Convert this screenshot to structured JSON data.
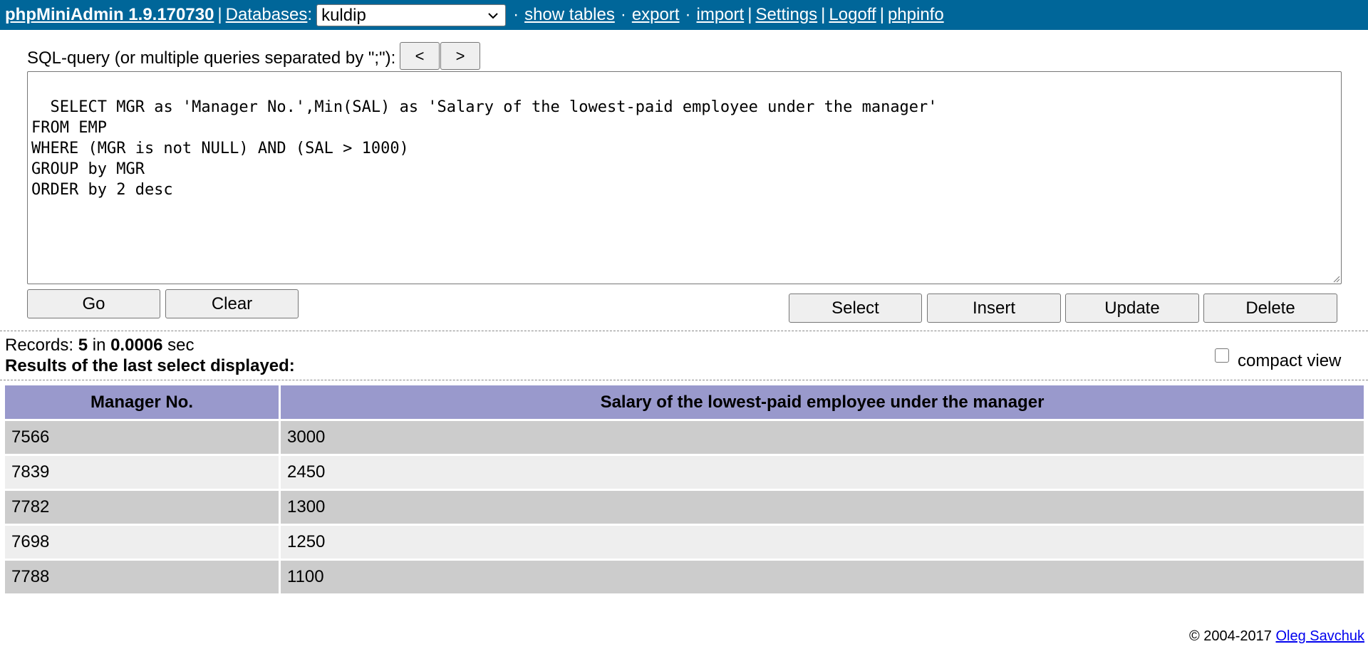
{
  "topbar": {
    "brand": "phpMiniAdmin 1.9.170730",
    "pipe": "|",
    "databases_label": "Databases",
    "colon": ":",
    "selected_db": "kuldip",
    "dot": "·",
    "show_tables": "show tables",
    "export": "export",
    "import": "import",
    "settings": "Settings",
    "logoff": "Logoff",
    "phpinfo": "phpinfo"
  },
  "sql": {
    "label": "SQL-query (or multiple queries separated by \";\"):",
    "prev": "<",
    "next": ">",
    "query": "SELECT MGR as 'Manager No.',Min(SAL) as 'Salary of the lowest-paid employee under the manager'\nFROM EMP\nWHERE (MGR is not NULL) AND (SAL > 1000)\nGROUP by MGR\nORDER by 2 desc",
    "go": "Go",
    "clear": "Clear",
    "select": "Select",
    "insert": "Insert",
    "update": "Update",
    "delete": "Delete"
  },
  "status": {
    "records_label": "Records: ",
    "records_count": "5",
    "in_label": " in ",
    "time": "0.0006",
    "sec_label": " sec",
    "results_title": "Results of the last select displayed:",
    "compact_view": "compact view"
  },
  "table": {
    "headers": [
      "Manager No.",
      "Salary of the lowest-paid employee under the manager"
    ],
    "rows": [
      [
        "7566",
        "3000"
      ],
      [
        "7839",
        "2450"
      ],
      [
        "7782",
        "1300"
      ],
      [
        "7698",
        "1250"
      ],
      [
        "7788",
        "1100"
      ]
    ]
  },
  "footer": {
    "copyright": "© 2004-2017 ",
    "author": "Oleg Savchuk"
  }
}
